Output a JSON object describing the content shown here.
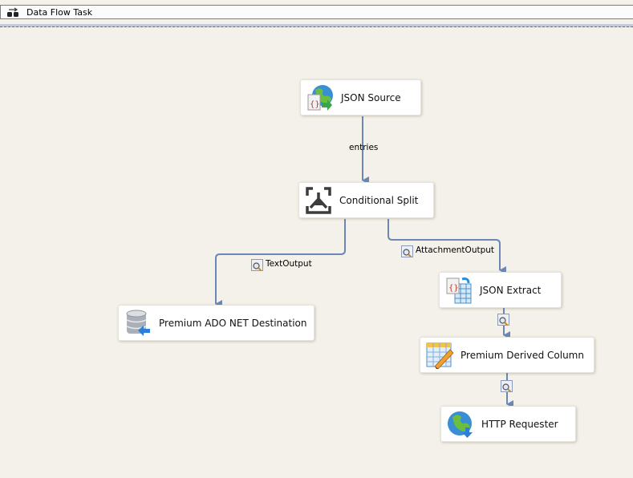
{
  "window": {
    "title": "Data Flow Task",
    "title_icon": "data-flow-task-icon"
  },
  "colors": {
    "canvas_background": "#f4f1ea",
    "flow_line": "#6b87b3",
    "node_background": "#ffffff"
  },
  "components": [
    {
      "id": "json-source",
      "label": "JSON Source",
      "icon": "json-source-icon"
    },
    {
      "id": "conditional-split",
      "label": "Conditional Split",
      "icon": "conditional-split-icon"
    },
    {
      "id": "ado-net-destination",
      "label": "Premium ADO NET Destination",
      "icon": "database-destination-icon"
    },
    {
      "id": "json-extract",
      "label": "JSON Extract",
      "icon": "json-extract-icon"
    },
    {
      "id": "derived-column",
      "label": "Premium Derived Column",
      "icon": "derived-column-icon"
    },
    {
      "id": "http-requester",
      "label": "HTTP Requester",
      "icon": "http-requester-icon"
    }
  ],
  "flows": [
    {
      "from": "JSON Source",
      "to": "Conditional Split",
      "label": "entries",
      "data_viewer": false
    },
    {
      "from": "Conditional Split",
      "to": "Premium ADO NET Destination",
      "label": "TextOutput",
      "data_viewer": true
    },
    {
      "from": "Conditional Split",
      "to": "JSON Extract",
      "label": "AttachmentOutput",
      "data_viewer": true
    },
    {
      "from": "JSON Extract",
      "to": "Premium Derived Column",
      "label": "",
      "data_viewer": true
    },
    {
      "from": "Premium Derived Column",
      "to": "HTTP Requester",
      "label": "",
      "data_viewer": true
    }
  ]
}
